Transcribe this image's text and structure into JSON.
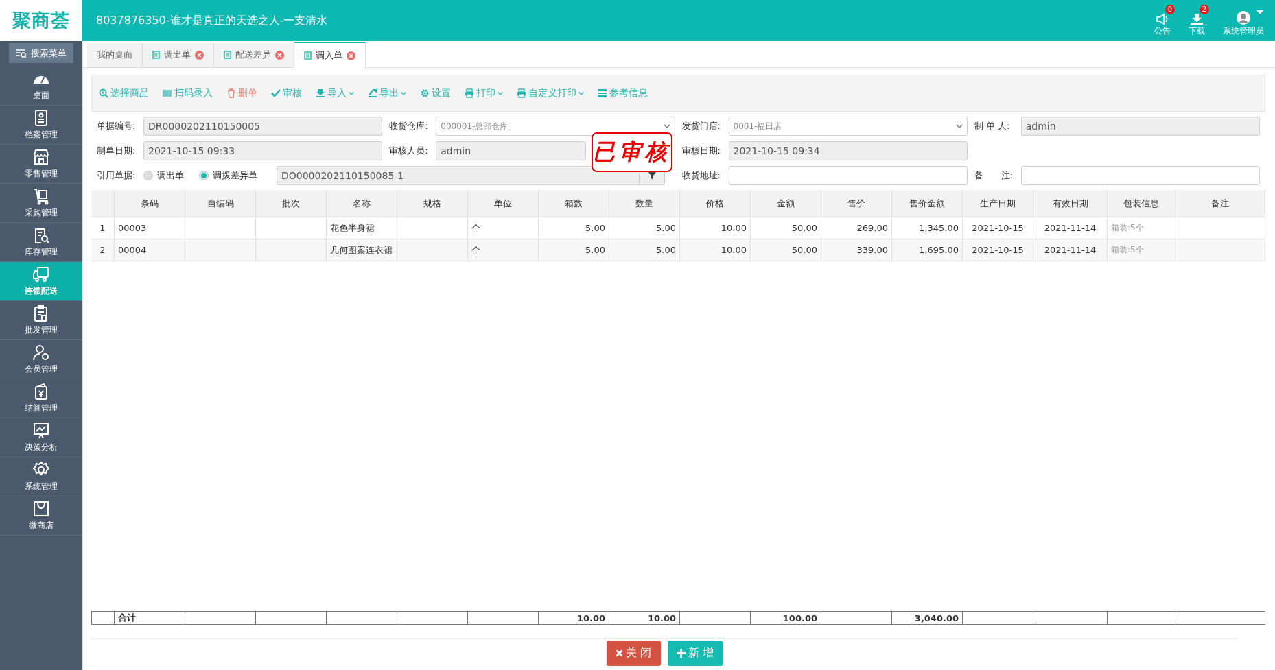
{
  "header": {
    "logo": "聚商荟",
    "title": "8037876350-谁才是真正的天选之人-一支清水",
    "actions": [
      {
        "kind": "notice",
        "label": "公告",
        "badge": "0"
      },
      {
        "kind": "download",
        "label": "下载",
        "badge": "2"
      },
      {
        "kind": "user",
        "label": "系统管理员"
      }
    ]
  },
  "sidebar": {
    "search": "搜索菜单",
    "items": [
      {
        "label": "桌面",
        "selected": false
      },
      {
        "label": "档案管理",
        "selected": false
      },
      {
        "label": "零售管理",
        "selected": false
      },
      {
        "label": "采购管理",
        "selected": false
      },
      {
        "label": "库存管理",
        "selected": false
      },
      {
        "label": "连锁配送",
        "selected": true
      },
      {
        "label": "批发管理",
        "selected": false
      },
      {
        "label": "会员管理",
        "selected": false
      },
      {
        "label": "结算管理",
        "selected": false
      },
      {
        "label": "决策分析",
        "selected": false
      },
      {
        "label": "系统管理",
        "selected": false
      },
      {
        "label": "微商店",
        "selected": false
      }
    ]
  },
  "tabs": [
    {
      "label": "我的桌面",
      "selected": false,
      "closable": false
    },
    {
      "label": "调出单",
      "selected": false,
      "closable": true
    },
    {
      "label": "配送差异",
      "selected": false,
      "closable": true
    },
    {
      "label": "调入单",
      "selected": true,
      "closable": true
    }
  ],
  "toolbar": [
    {
      "kind": "search",
      "label": "选择商品",
      "color": "#1fb5ad",
      "dropdown": false
    },
    {
      "kind": "barcode",
      "label": "扫码录入",
      "color": "#1fb5ad",
      "dropdown": false
    },
    {
      "kind": "trash",
      "label": "删单",
      "color": "#e9826f",
      "dropdown": false
    },
    {
      "kind": "check",
      "label": "审核",
      "color": "#1fb5ad",
      "dropdown": false
    },
    {
      "kind": "import",
      "label": "导入",
      "color": "#1fb5ad",
      "dropdown": true
    },
    {
      "kind": "export",
      "label": "导出",
      "color": "#1fb5ad",
      "dropdown": true
    },
    {
      "kind": "gear",
      "label": "设置",
      "color": "#1fb5ad",
      "dropdown": false
    },
    {
      "kind": "print",
      "label": "打印",
      "color": "#1fb5ad",
      "dropdown": true
    },
    {
      "kind": "print",
      "label": "自定义打印",
      "color": "#1fb5ad",
      "dropdown": true
    },
    {
      "kind": "list",
      "label": "参考信息",
      "color": "#1fb5ad",
      "dropdown": false
    }
  ],
  "form": {
    "fields": [
      {
        "label": "单据编号:",
        "kind": "readonly",
        "value": "DR0000202110150005"
      },
      {
        "label": "收货仓库:",
        "kind": "select",
        "value": "000001-总部仓库"
      },
      {
        "label": "发货门店:",
        "kind": "select",
        "value": "0001-福田店"
      },
      {
        "label": "制 单 人:",
        "kind": "readonly",
        "value": "admin"
      },
      {
        "label": "制单日期:",
        "kind": "readonly",
        "value": "2021-10-15 09:33"
      },
      {
        "label": "审核人员:",
        "kind": "readonly",
        "value": "admin"
      },
      {
        "label": "审核日期:",
        "kind": "readonly",
        "value": "2021-10-15 09:34"
      },
      {
        "kind": "empty"
      },
      {
        "label": "引用单据:",
        "kind": "reference",
        "options": [
          {
            "label": "调出单",
            "selected": false
          },
          {
            "label": "调拨差异单",
            "selected": true
          }
        ],
        "value": "DO0000202110150085-1"
      },
      {
        "label": "收货地址:",
        "kind": "text"
      },
      {
        "label": "备　　注:",
        "kind": "text"
      }
    ],
    "stamp": "已审核"
  },
  "table": {
    "columns": [
      "条码",
      "自编码",
      "批次",
      "名称",
      "规格",
      "单位",
      "箱数",
      "数量",
      "价格",
      "金额",
      "售价",
      "售价金额",
      "生产日期",
      "有效日期",
      "包装信息",
      "备注"
    ],
    "rows": [
      {
        "index": "1",
        "cells": [
          "00003",
          "",
          "",
          "花色半身裙",
          "",
          "个",
          "5.00",
          "5.00",
          "10.00",
          "50.00",
          "269.00",
          "1,345.00",
          "2021-10-15",
          "2021-11-14",
          "箱装:5个",
          ""
        ]
      },
      {
        "index": "2",
        "cells": [
          "00004",
          "",
          "",
          "几何图案连衣裙",
          "",
          "个",
          "5.00",
          "5.00",
          "10.00",
          "50.00",
          "339.00",
          "1,695.00",
          "2021-10-15",
          "2021-11-14",
          "箱装:5个",
          ""
        ]
      }
    ],
    "total": {
      "label": "合计",
      "cells": [
        "",
        "",
        "",
        "",
        "",
        "",
        "10.00",
        "10.00",
        "",
        "100.00",
        "",
        "3,040.00",
        "",
        "",
        "",
        ""
      ]
    }
  },
  "buttons": [
    {
      "kind": "close",
      "label": "关 闭"
    },
    {
      "kind": "add",
      "label": "新 增"
    }
  ]
}
